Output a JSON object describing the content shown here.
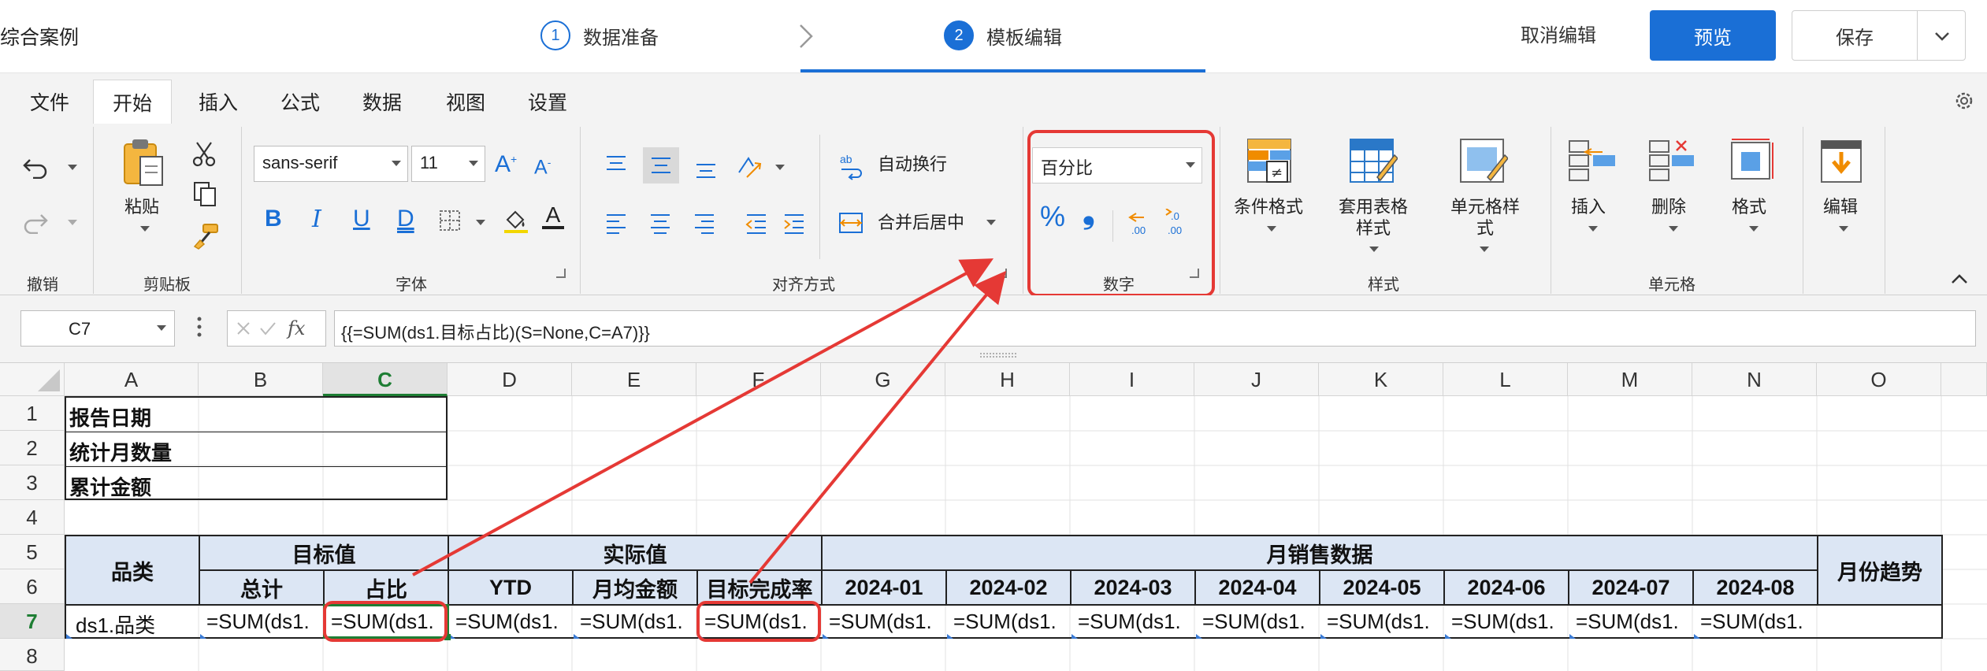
{
  "topbar": {
    "case_title": "综合案例",
    "steps": [
      {
        "num": "1",
        "label": "数据准备"
      },
      {
        "num": "2",
        "label": "模板编辑"
      }
    ],
    "cancel_label": "取消编辑",
    "preview_label": "预览",
    "save_label": "保存"
  },
  "tabs": [
    "文件",
    "开始",
    "插入",
    "公式",
    "数据",
    "视图",
    "设置"
  ],
  "ribbon": {
    "groups": {
      "undo": "撤销",
      "clipboard": "剪贴板",
      "font": "字体",
      "align": "对齐方式",
      "number": "数字",
      "style": "样式",
      "cells": "单元格"
    },
    "paste_label": "粘贴",
    "font_name": "sans-serif",
    "font_size": "11",
    "font_grow": "A",
    "font_shrink": "A",
    "bold": "B",
    "italic": "I",
    "underline": "U",
    "double_underline": "D",
    "font_color_glyph": "A",
    "wrap_label": "自动换行",
    "merge_label": "合并后居中",
    "number_format": "百分比",
    "percent_glyph": "%",
    "comma_glyph": "❟",
    "cond_format_label": "条件格式",
    "table_style_label": "套用表格\n样式",
    "cell_style_label": "单元格样\n式",
    "insert_label": "插入",
    "delete_label": "删除",
    "format_label": "格式",
    "edit_label": "编辑"
  },
  "formula_bar": {
    "cell_ref": "C7",
    "formula": "{{=SUM(ds1.目标占比)(S=None,C=A7)}}"
  },
  "columns": [
    "A",
    "B",
    "C",
    "D",
    "E",
    "F",
    "G",
    "H",
    "I",
    "J",
    "K",
    "L",
    "M",
    "N",
    "O"
  ],
  "rows": [
    "1",
    "2",
    "3",
    "4",
    "5",
    "6",
    "7",
    "8"
  ],
  "cells": {
    "a1": "报告日期",
    "a2": "统计月数量",
    "a3": "累计金额",
    "category": "品类",
    "target": "目标值",
    "actual": "实际值",
    "monthly_sales": "月销售数据",
    "trend": "月份趋势",
    "total": "总计",
    "ratio": "占比",
    "ytd": "YTD",
    "monthly_avg": "月均金额",
    "completion": "目标完成率",
    "months": [
      "2024-01",
      "2024-02",
      "2024-03",
      "2024-04",
      "2024-05",
      "2024-06",
      "2024-07",
      "2024-08"
    ],
    "row7_a": "ds1.品类",
    "sum_text": "=SUM(ds1."
  },
  "colors": {
    "accent": "#1a6fd6",
    "header_fill": "#dce6f4",
    "highlight": "#e53935",
    "selection": "#1e7e34"
  }
}
